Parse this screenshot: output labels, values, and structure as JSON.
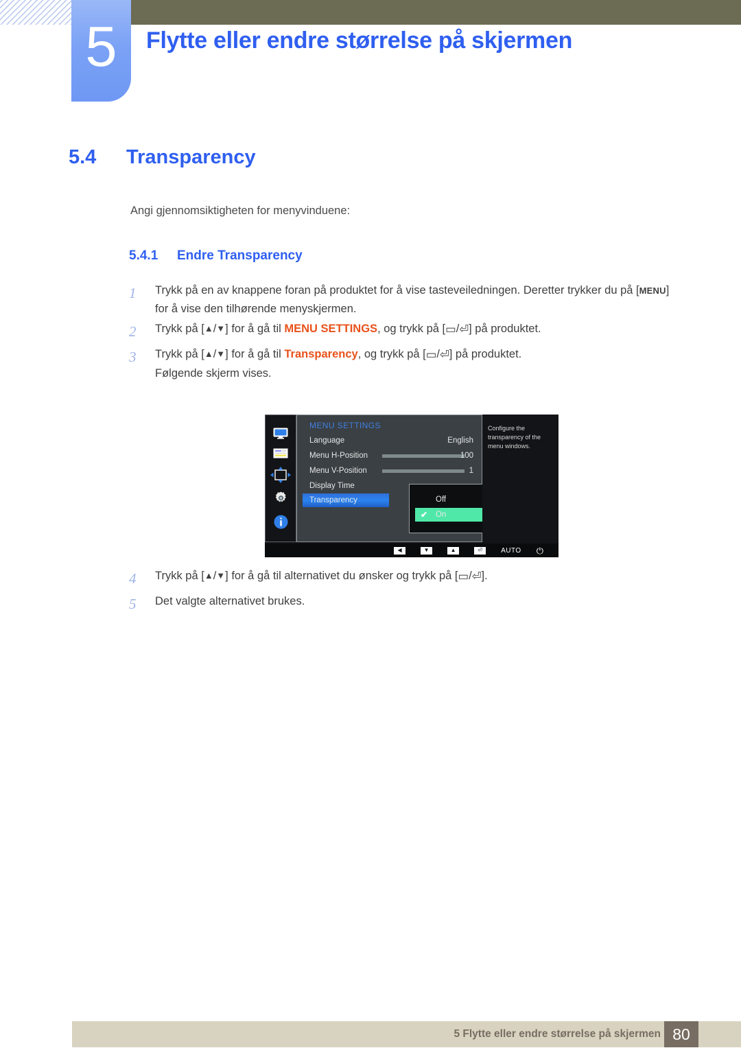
{
  "header": {
    "chapter_number": "5",
    "chapter_title": "Flytte eller endre størrelse på skjermen"
  },
  "section": {
    "number": "5.4",
    "title": "Transparency",
    "intro": "Angi gjennomsiktigheten for menyvinduene:",
    "subsection_number": "5.4.1",
    "subsection_title": "Endre Transparency"
  },
  "steps": [
    {
      "num": "1",
      "part1": "Trykk på en av knappene foran på produktet for å vise tasteveiledningen. Deretter trykker du på [",
      "key": "MENU",
      "part2": "] for å vise den tilhørende menyskjermen."
    },
    {
      "num": "2",
      "part1": "Trykk på [",
      "up": "▲",
      "slash": "/",
      "down": "▼",
      "part2": "] for å gå til ",
      "highlight": "MENU SETTINGS",
      "part3": ", og trykk på [",
      "glyph1": "▭",
      "glyph2": "⏎",
      "part4": "] på produktet."
    },
    {
      "num": "3",
      "part1": "Trykk på [",
      "up": "▲",
      "slash": "/",
      "down": "▼",
      "part2": "] for å gå til ",
      "highlight": "Transparency",
      "part3": ", og trykk på [",
      "glyph1": "▭",
      "glyph2": "⏎",
      "part4": "] på produktet.",
      "followup": "Følgende skjerm vises."
    },
    {
      "num": "4",
      "part1": "Trykk på [",
      "up": "▲",
      "slash": "/",
      "down": "▼",
      "part2": "] for å gå til alternativet du ønsker og trykk på [",
      "glyph1": "▭",
      "glyph2": "⏎",
      "part4": "]."
    },
    {
      "num": "5",
      "part1": "Det valgte alternativet brukes."
    }
  ],
  "osd": {
    "menu_title": "MENU SETTINGS",
    "sidebar_icons": [
      "monitor-icon",
      "picture-icon",
      "position-arrows-icon",
      "gear-icon",
      "information-icon"
    ],
    "rows": [
      {
        "label": "Language",
        "value": "English",
        "type": "value"
      },
      {
        "label": "Menu H-Position",
        "value": "100",
        "type": "slider",
        "fill_percent": 100
      },
      {
        "label": "Menu V-Position",
        "value": "1",
        "type": "slider",
        "fill_percent": 4
      },
      {
        "label": "Display Time",
        "value": "",
        "type": "plain"
      },
      {
        "label": "Transparency",
        "value": "",
        "type": "selected"
      }
    ],
    "popup": {
      "options": [
        {
          "label": "Off",
          "selected": false,
          "check": ""
        },
        {
          "label": "On",
          "selected": true,
          "check": "✔"
        }
      ]
    },
    "help_text": "Configure the transparency of the menu windows.",
    "bottom_bar": {
      "left_label": "◀",
      "down_label": "▼",
      "up_label": "▲",
      "enter_label": "⏎",
      "auto_label": "AUTO",
      "power_label": "⏻"
    },
    "colors": {
      "selected_row": "#2b84f0",
      "popup_selected": "#4fe8a8",
      "menu_title": "#3f7fe0"
    }
  },
  "footer": {
    "text": "5 Flytte eller endre størrelse på skjermen",
    "page_number": "80"
  },
  "colors": {
    "accent_blue": "#2f5ff0",
    "highlight_orange": "#e8521b",
    "olive": "#6c6b54",
    "footer_beige": "#d8d3c0",
    "footer_brown": "#786d62"
  }
}
